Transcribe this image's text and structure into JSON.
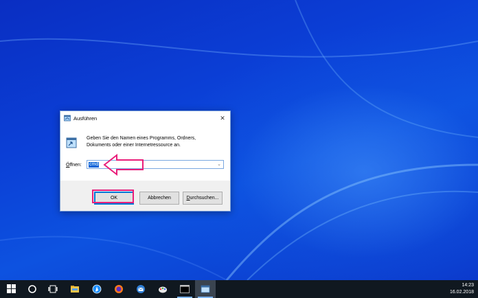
{
  "dialog": {
    "title": "Ausführen",
    "close_symbol": "✕",
    "description_line1": "Geben Sie den Namen eines Programms, Ordners,",
    "description_line2": "Dokuments oder einer Internetressource an.",
    "open_label_prefix": "",
    "open_label_accesskey": "Ö",
    "open_label_rest": "ffnen:",
    "input_value": "cmd",
    "buttons": {
      "ok": "OK",
      "cancel": "Abbrechen",
      "browse_prefix": "",
      "browse_accesskey": "D",
      "browse_rest": "urchsuchen..."
    },
    "annotation_color": "#e91e7a"
  },
  "taskbar": {
    "items": [
      "windows-start-icon",
      "cortana-icon",
      "task-view-icon",
      "file-explorer-icon",
      "safari-icon",
      "firefox-icon",
      "thunderbird-icon",
      "paint-icon",
      "console-icon",
      "run-dialog-icon"
    ],
    "clock_time": "14:23",
    "clock_date": "16.02.2018"
  }
}
